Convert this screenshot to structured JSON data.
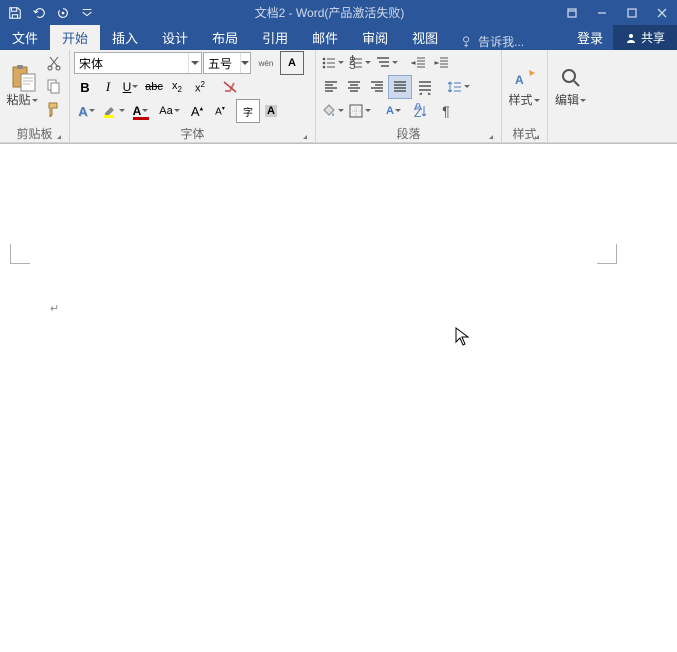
{
  "title": "文档2 - Word(产品激活失败)",
  "tabs": {
    "file": "文件",
    "home": "开始",
    "insert": "插入",
    "design": "设计",
    "layout": "布局",
    "references": "引用",
    "mailings": "邮件",
    "review": "审阅",
    "view": "视图"
  },
  "tellme": "告诉我...",
  "signin": "登录",
  "share": "共享",
  "font": {
    "name": "宋体",
    "size": "五号"
  },
  "groups": {
    "clipboard": "剪贴板",
    "font": "字体",
    "paragraph": "段落",
    "styles": "样式",
    "editing": "编辑"
  },
  "buttons": {
    "paste": "粘贴",
    "styles": "样式",
    "editing": "编辑"
  },
  "pinyin": "wén"
}
